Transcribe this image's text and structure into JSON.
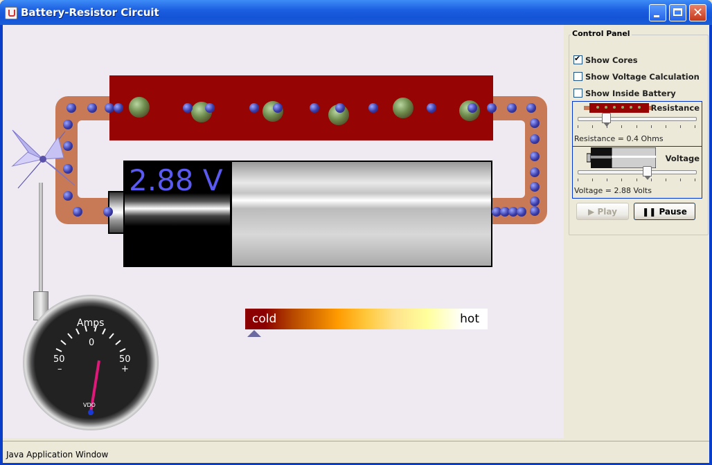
{
  "window": {
    "title": "Battery-Resistor Circuit",
    "minimize_icon": "minimize-icon",
    "maximize_icon": "maximize-icon",
    "close_icon": "close-icon",
    "close_glyph": "✕"
  },
  "status_bar": {
    "text": "Java Application Window"
  },
  "circuit": {
    "battery_voltage_label": "2.88 V",
    "ammeter": {
      "title": "Amps",
      "left_value": "50",
      "left_sign": "–",
      "center_value": "0",
      "right_value": "50",
      "right_sign": "+",
      "brand": "VDO"
    },
    "heat_bar": {
      "cold_label": "cold",
      "hot_label": "hot"
    },
    "colors": {
      "wire": "#c77a55",
      "resistor": "#960404",
      "electron": "#3a3aa6",
      "voltage_text": "#5a5af0",
      "needle": "#e0187a"
    }
  },
  "control_panel": {
    "title": "Control Panel",
    "checkboxes": [
      {
        "label": "Show Cores",
        "checked": true
      },
      {
        "label": "Show Voltage Calculation",
        "checked": false
      },
      {
        "label": "Show Inside Battery",
        "checked": false
      }
    ],
    "resistance": {
      "label": "Resistance",
      "readout": "Resistance = 0.4 Ohms"
    },
    "voltage": {
      "label": "Voltage",
      "readout": "Voltage = 2.88 Volts"
    },
    "buttons": {
      "play_label": "Play",
      "pause_label": "Pause",
      "play_icon": "play-icon",
      "pause_icon": "pause-icon"
    }
  }
}
